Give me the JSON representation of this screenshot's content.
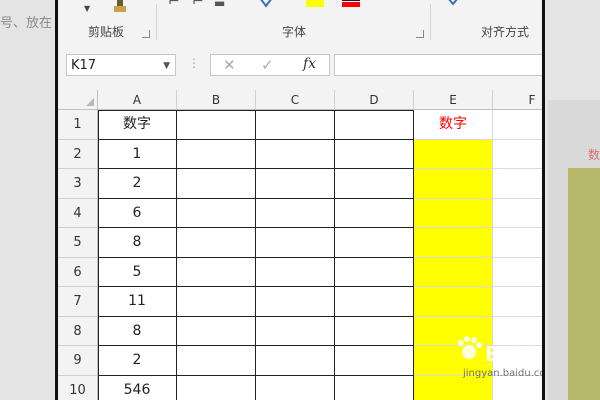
{
  "background_text": "号、放在",
  "background_red_text": "数",
  "ribbon": {
    "groups": [
      {
        "label": "剪贴板"
      },
      {
        "label": "字体"
      },
      {
        "label": "对齐方式"
      }
    ],
    "icons": [
      "dropdown-arrow-icon",
      "format-painter-icon",
      "bold-icon",
      "italic-icon",
      "underline-icon",
      "fill-color-icon",
      "font-color-icon",
      "wrap-text-icon"
    ]
  },
  "formula_bar": {
    "name_box": "K17",
    "cancel_glyph": "✕",
    "enter_glyph": "✓",
    "fx_label": "fx",
    "formula": ""
  },
  "columns": [
    "A",
    "B",
    "C",
    "D",
    "E",
    "F"
  ],
  "rows": [
    {
      "num": "1",
      "A": "数字",
      "E": "数字"
    },
    {
      "num": "2",
      "A": "1",
      "E": ""
    },
    {
      "num": "3",
      "A": "2",
      "E": ""
    },
    {
      "num": "4",
      "A": "6",
      "E": ""
    },
    {
      "num": "5",
      "A": "8",
      "E": ""
    },
    {
      "num": "6",
      "A": "5",
      "E": ""
    },
    {
      "num": "7",
      "A": "11",
      "E": ""
    },
    {
      "num": "8",
      "A": "8",
      "E": ""
    },
    {
      "num": "9",
      "A": "2",
      "E": ""
    },
    {
      "num": "10",
      "A": "546",
      "E": ""
    }
  ],
  "colors": {
    "highlight_fill": "#ffff00",
    "header_text_red": "#ff0000"
  },
  "watermark": {
    "text": "Baidu经验",
    "sub": "jingyan.baidu.com"
  }
}
